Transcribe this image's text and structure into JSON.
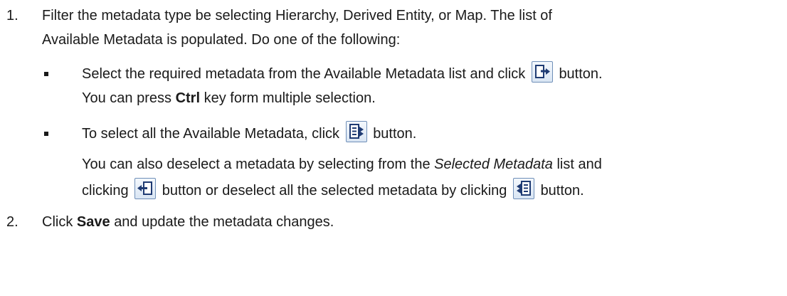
{
  "steps": [
    {
      "number": "1.",
      "lines": [
        "Filter the metadata type be selecting Hierarchy, Derived Entity, or Map. The list of",
        "Available Metadata is populated. Do one of the following:"
      ],
      "bullets": [
        {
          "line1_text": "Select the required metadata from the Available Metadata list and click",
          "line1_icon": "move-right-icon",
          "line1_after": "button.",
          "line2_pre": "You can press",
          "line2_bold": "Ctrl",
          "line2_post": "key form multiple selection."
        },
        {
          "line1_text": "To select all the Available Metadata, click",
          "line1_icon": "move-all-right-icon",
          "line1_after": "button.",
          "note_pre": "You can also deselect a metadata by selecting from the",
          "note_italic": "Selected Metadata",
          "note_post": "list and",
          "note2_pre": "clicking",
          "note2_icon1": "move-left-icon",
          "note2_mid": "button or deselect all the selected metadata by clicking",
          "note2_icon2": "move-all-left-icon",
          "note2_post": "button."
        }
      ]
    },
    {
      "number": "2.",
      "pre": "Click",
      "bold": "Save",
      "post": "and update the metadata changes."
    }
  ]
}
